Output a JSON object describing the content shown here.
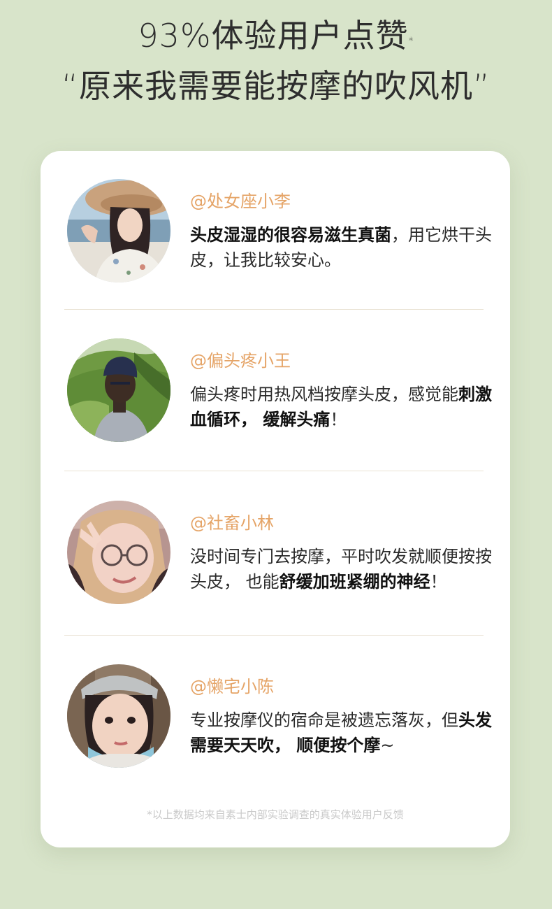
{
  "header": {
    "line1": "93%体验用户点赞",
    "line1_mark": "*",
    "line2": "“原来我需要能按摩的吹风机”"
  },
  "reviews": [
    {
      "user": "@处女座小李",
      "avatar_icon": "woman-straw-hat-photo",
      "segments": [
        {
          "text": "头皮湿湿的很容易滋生真菌",
          "bold": true
        },
        {
          "text": "，用它烘干头皮，让我比较安心。",
          "bold": false
        }
      ]
    },
    {
      "user": "@偏头疼小王",
      "avatar_icon": "man-cap-hillside-photo",
      "segments": [
        {
          "text": "偏头疼时用热风档按摩头皮，感觉能",
          "bold": false
        },
        {
          "text": "刺激血循环， 缓解头痛",
          "bold": true
        },
        {
          "text": "！",
          "bold": false
        }
      ]
    },
    {
      "user": "@社畜小林",
      "avatar_icon": "girl-glasses-peace-sign-photo",
      "segments": [
        {
          "text": "没时间专门去按摩，平时吹发就顺便按按头皮， 也能",
          "bold": false
        },
        {
          "text": "舒缓加班紧绷的神经",
          "bold": true
        },
        {
          "text": "！",
          "bold": false
        }
      ]
    },
    {
      "user": "@懒宅小陈",
      "avatar_icon": "girl-cap-mask-photo",
      "segments": [
        {
          "text": "专业按摩仪的宿命是被遗忘落灰，但",
          "bold": false
        },
        {
          "text": "头发需要天天吹， 顺便按个摩",
          "bold": true
        },
        {
          "text": "~",
          "bold": false
        }
      ]
    }
  ],
  "footnote": "*以上数据均来自素士内部实验调查的真实体验用户反馈",
  "colors": {
    "page_bg": "#d8e4ca",
    "card_bg": "#ffffff",
    "username": "#e5a467",
    "divider": "#e9e2d3",
    "footnote": "#c9c9c9"
  }
}
